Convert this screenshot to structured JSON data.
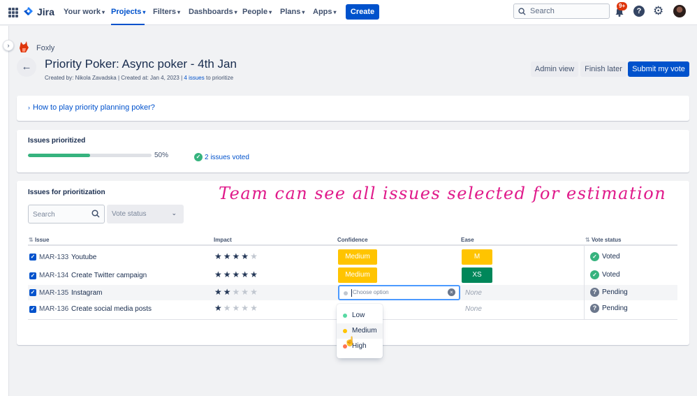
{
  "nav": {
    "logo": "Jira",
    "items": [
      {
        "label": "Your work",
        "active": false
      },
      {
        "label": "Projects",
        "active": true
      },
      {
        "label": "Filters",
        "active": false
      },
      {
        "label": "Dashboards",
        "active": false
      },
      {
        "label": "People",
        "active": false
      },
      {
        "label": "Plans",
        "active": false
      },
      {
        "label": "Apps",
        "active": false
      }
    ],
    "create_label": "Create",
    "search_placeholder": "Search",
    "notification_count": "9+"
  },
  "header": {
    "project_name": "Foxly",
    "title": "Priority Poker: Async poker - 4th Jan",
    "meta_prefix": "Created by: Nikola Zavadska | Created at: Jan 4, 2023 |",
    "meta_link": "4 issues",
    "meta_suffix": "to prioritize",
    "admin_view": "Admin view",
    "finish_later": "Finish later",
    "submit": "Submit my vote"
  },
  "howto": {
    "label": "How to play priority planning poker?"
  },
  "progress": {
    "title": "Issues prioritized",
    "percent": 50,
    "percent_label": "50%",
    "voted_label": "2 issues voted"
  },
  "issues": {
    "title": "Issues for prioritization",
    "annotation": "Team can see all issues selected for estimation",
    "search_placeholder": "Search",
    "vote_filter_placeholder": "Vote status",
    "columns": [
      "Issue",
      "Impact",
      "Confidence",
      "Ease",
      "Vote status"
    ],
    "rows": [
      {
        "key": "MAR-133",
        "title": "Youtube",
        "impact": 4,
        "confidence": "Medium",
        "ease": "M",
        "status": "Voted"
      },
      {
        "key": "MAR-134",
        "title": "Create Twitter campaign",
        "impact": 5,
        "confidence": "Medium",
        "ease": "XS",
        "status": "Voted"
      },
      {
        "key": "MAR-135",
        "title": "Instagram",
        "impact": 2,
        "confidence_placeholder": "Choose option",
        "ease": "None",
        "status": "Pending"
      },
      {
        "key": "MAR-136",
        "title": "Create social media posts",
        "impact": 1,
        "confidence": "",
        "ease": "None",
        "status": "Pending"
      }
    ],
    "dropdown_options": [
      {
        "label": "Low",
        "color": "#57d9a3"
      },
      {
        "label": "Medium",
        "color": "#ffc400"
      },
      {
        "label": "High",
        "color": "#ff7452"
      }
    ]
  },
  "colors": {
    "brand": "#0052cc",
    "success": "#36b37e",
    "annotation": "#e0198a"
  }
}
